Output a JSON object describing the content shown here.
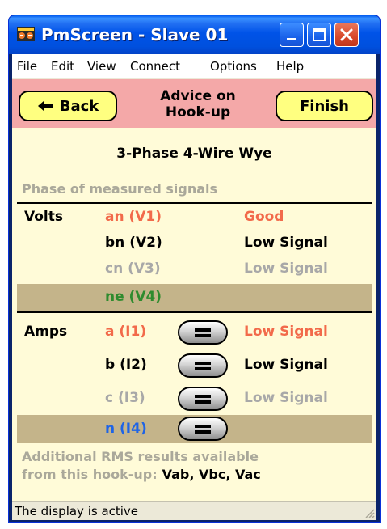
{
  "window": {
    "title": "PmScreen - Slave 01"
  },
  "menu": {
    "items": [
      "File",
      "Edit",
      "View",
      "Connect",
      "Options",
      "Help"
    ]
  },
  "header": {
    "back_label": "Back",
    "title_line1": "Advice on",
    "title_line2": "Hook-up",
    "finish_label": "Finish",
    "band_color": "#f4a8a8",
    "button_color": "#ffff80"
  },
  "main": {
    "wiring": "3-Phase 4-Wire Wye",
    "section_heading": "Phase of measured signals",
    "volts": {
      "label": "Volts",
      "rows": [
        {
          "signal": "an (V1)",
          "status": "Good",
          "signal_color": "#f26a4a",
          "status_color": "#f26a4a"
        },
        {
          "signal": "bn (V2)",
          "status": "Low Signal",
          "signal_color": "#000000",
          "status_color": "#000000"
        },
        {
          "signal": "cn (V3)",
          "status": "Low Signal",
          "signal_color": "#a8a8a8",
          "status_color": "#a8a8a8"
        },
        {
          "signal": "ne (V4)",
          "status": "",
          "signal_color": "#2e8b2e",
          "status_color": "#2e8b2e"
        }
      ]
    },
    "amps": {
      "label": "Amps",
      "rows": [
        {
          "signal": "a (I1)",
          "status": "Low Signal",
          "signal_color": "#f26a4a",
          "status_color": "#f26a4a"
        },
        {
          "signal": "b (I2)",
          "status": "Low Signal",
          "signal_color": "#000000",
          "status_color": "#000000"
        },
        {
          "signal": "c (I3)",
          "status": "Low Signal",
          "signal_color": "#a8a8a8",
          "status_color": "#a8a8a8"
        },
        {
          "signal": "n (I4)",
          "status": "",
          "signal_color": "#1e64e6",
          "status_color": "#1e64e6"
        }
      ]
    },
    "footer_line1": "Additional RMS results available",
    "footer_line2": "from this hook-up:",
    "rms_values": "Vab, Vbc, Vac",
    "band_color": "#c4b48a",
    "icons": {
      "swap_button": "equals-icon"
    }
  },
  "statusbar": {
    "text": "The display is active"
  }
}
